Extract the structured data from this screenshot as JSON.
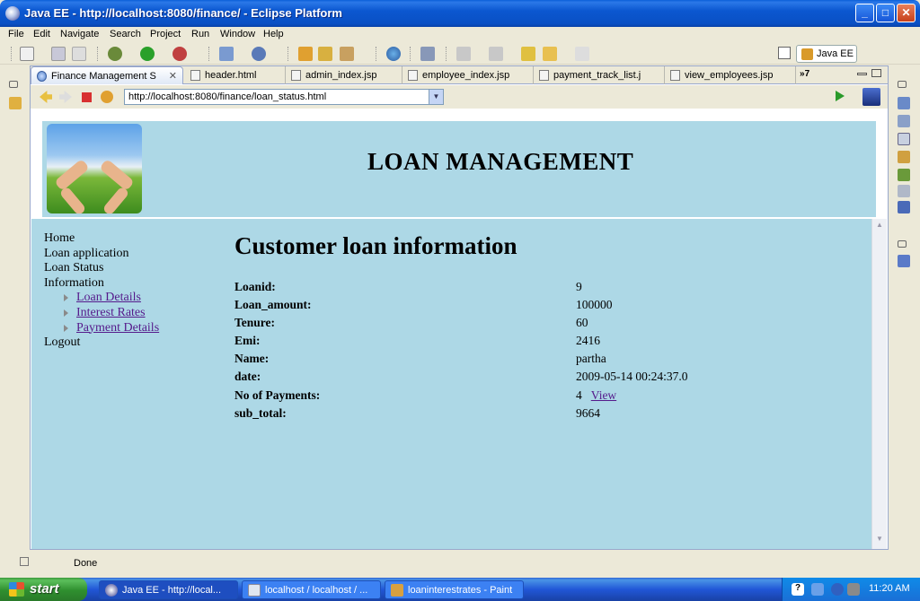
{
  "window": {
    "title": "Java EE - http://localhost:8080/finance/ - Eclipse Platform"
  },
  "menu": [
    "File",
    "Edit",
    "Navigate",
    "Search",
    "Project",
    "Run",
    "Window",
    "Help"
  ],
  "perspective": {
    "label": "Java EE"
  },
  "tabs": [
    {
      "label": "Finance Management S",
      "active": true
    },
    {
      "label": "header.html"
    },
    {
      "label": "admin_index.jsp"
    },
    {
      "label": "employee_index.jsp"
    },
    {
      "label": "payment_track_list.j"
    },
    {
      "label": "view_employees.jsp"
    }
  ],
  "tabs_overflow": "7",
  "browser": {
    "url": "http://localhost:8080/finance/loan_status.html"
  },
  "page": {
    "site_title": "LOAN MANAGEMENT",
    "nav": {
      "home": "Home",
      "loan_application": "Loan application",
      "loan_status": "Loan Status",
      "information": "Information",
      "loan_details": "Loan Details",
      "interest_rates": "Interest Rates",
      "payment_details": "Payment Details",
      "logout": "Logout"
    },
    "heading": "Customer loan information",
    "rows": [
      {
        "label": "Loanid:",
        "value": "9"
      },
      {
        "label": "Loan_amount:",
        "value": "100000"
      },
      {
        "label": "Tenure:",
        "value": "60"
      },
      {
        "label": "Emi:",
        "value": "2416"
      },
      {
        "label": "Name:",
        "value": "partha"
      },
      {
        "label": "date:",
        "value": "2009-05-14 00:24:37.0"
      },
      {
        "label": "No of Payments:",
        "value": "4",
        "link": "View"
      },
      {
        "label": "sub_total:",
        "value": "9664"
      }
    ]
  },
  "status": {
    "text": "Done"
  },
  "taskbar": {
    "start": "start",
    "tasks": [
      {
        "label": "Java EE - http://local...",
        "active": true
      },
      {
        "label": "localhost / localhost / ..."
      },
      {
        "label": "loaninterestrates - Paint"
      }
    ],
    "clock": "11:20 AM"
  }
}
